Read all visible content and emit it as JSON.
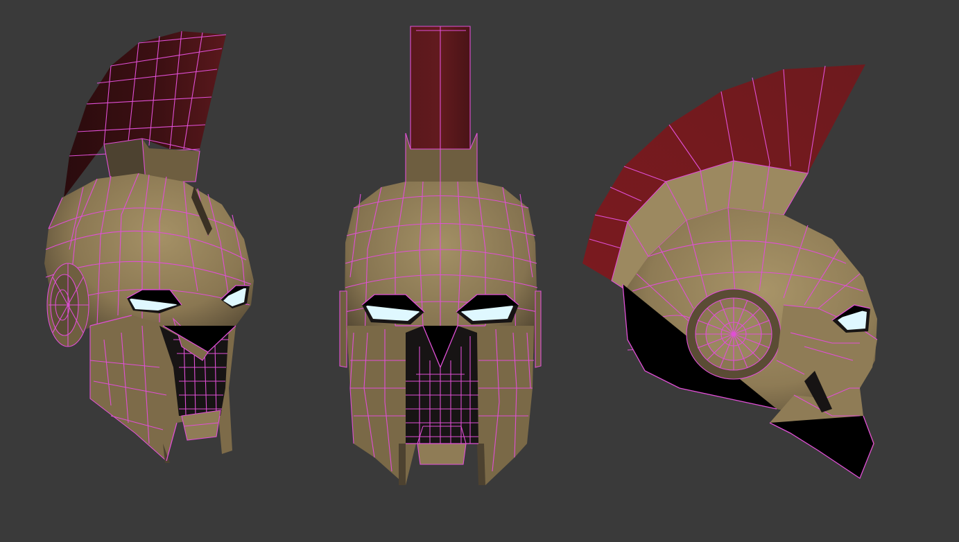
{
  "scene": {
    "background_color": "#3a3a3a",
    "wireframe_color": "#e04fd6",
    "helmet_color": "#8c7a55",
    "helmet_highlight": "#a08d62",
    "helmet_shadow": "#4e4330",
    "crest_color": "#6e1a1e",
    "crest_shadow": "#3a0f12",
    "eye_glow_color": "#dff8ff",
    "mask_color": "#151313"
  },
  "views": [
    {
      "name": "three-quarter-view"
    },
    {
      "name": "front-view"
    },
    {
      "name": "side-view"
    }
  ]
}
